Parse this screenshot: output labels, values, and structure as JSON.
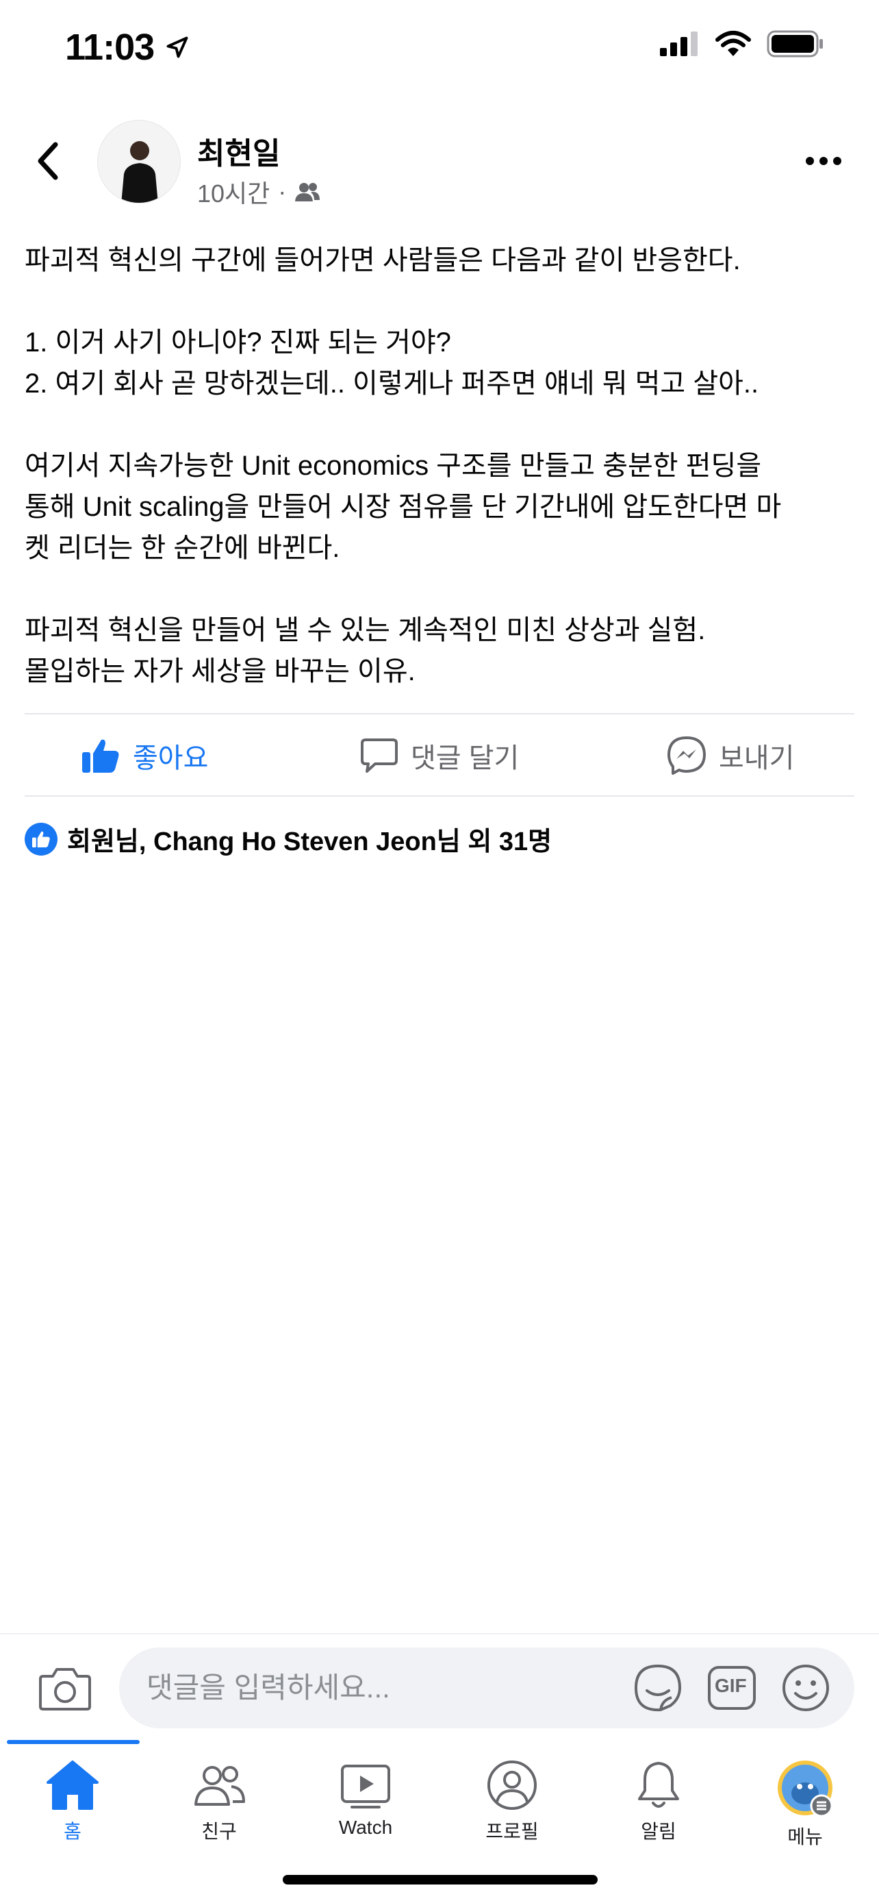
{
  "status_bar": {
    "time": "11:03",
    "icons": [
      "location-arrow-icon",
      "cellular-signal-icon",
      "wifi-icon",
      "battery-icon"
    ]
  },
  "post": {
    "author": "최현일",
    "time": "10시간",
    "separator": "·",
    "audience_icon": "friends-icon",
    "body": {
      "line1": "파괴적 혁신의 구간에 들어가면 사람들은 다음과 같이 반응한다.",
      "line2": "1. 이거 사기 아니야? 진짜 되는 거야?",
      "line3": "2. 여기 회사 곧 망하겠는데.. 이렇게나 퍼주면 얘네 뭐 먹고 살아..",
      "line4": "여기서 지속가능한 Unit economics 구조를 만들고 충분한 펀딩을",
      "line5": "통해 Unit scaling을 만들어 시장 점유를 단 기간내에 압도한다면 마",
      "line6": "켓 리더는 한 순간에 바뀐다.",
      "line7": "파괴적 혁신을 만들어 낼 수 있는 계속적인 미친 상상과 실험.",
      "line8": "몰입하는 자가 세상을 바꾸는 이유."
    },
    "actions": {
      "like": "좋아요",
      "comment": "댓글 달기",
      "send": "보내기"
    },
    "reactions_text": "회원님, Chang Ho Steven Jeon님 외 31명"
  },
  "composer": {
    "placeholder": "댓글을 입력하세요...",
    "gif_label": "GIF"
  },
  "tabs": [
    {
      "label": "홈",
      "icon": "home-icon",
      "active": true
    },
    {
      "label": "친구",
      "icon": "friends-icon"
    },
    {
      "label": "Watch",
      "icon": "watch-icon"
    },
    {
      "label": "프로필",
      "icon": "profile-icon"
    },
    {
      "label": "알림",
      "icon": "bell-icon"
    },
    {
      "label": "메뉴",
      "icon": "menu-avatar-icon"
    }
  ],
  "colors": {
    "accent": "#1877f2",
    "secondary_text": "#65676b",
    "divider": "#e4e6eb"
  }
}
